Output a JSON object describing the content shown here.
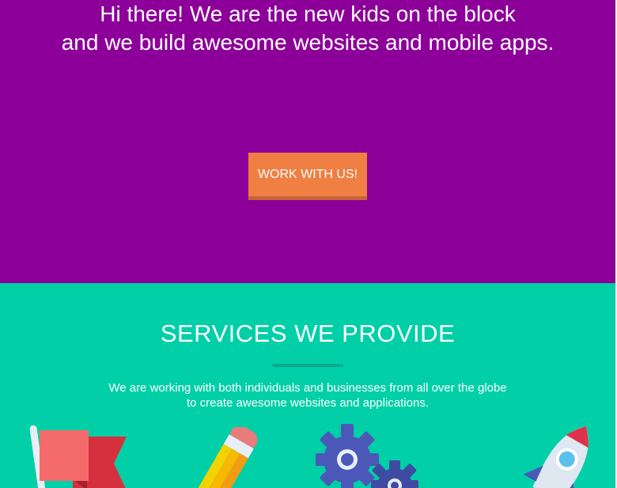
{
  "hero": {
    "headline_line1": "Hi there! We are the new kids on the block",
    "headline_line2": "and we build awesome websites and mobile apps.",
    "cta_label": "WORK WITH US!"
  },
  "services": {
    "title": "SERVICES WE PROVIDE",
    "description_line1": "We are working with both individuals and businesses from all over the globe",
    "description_line2": "to create awesome websites and applications.",
    "icons": [
      "flag-icon",
      "pencil-icon",
      "gears-icon",
      "rocket-icon"
    ]
  },
  "colors": {
    "hero_bg": "#8c0099",
    "cta_bg": "#ef7f43",
    "services_bg": "#00cfa7"
  }
}
